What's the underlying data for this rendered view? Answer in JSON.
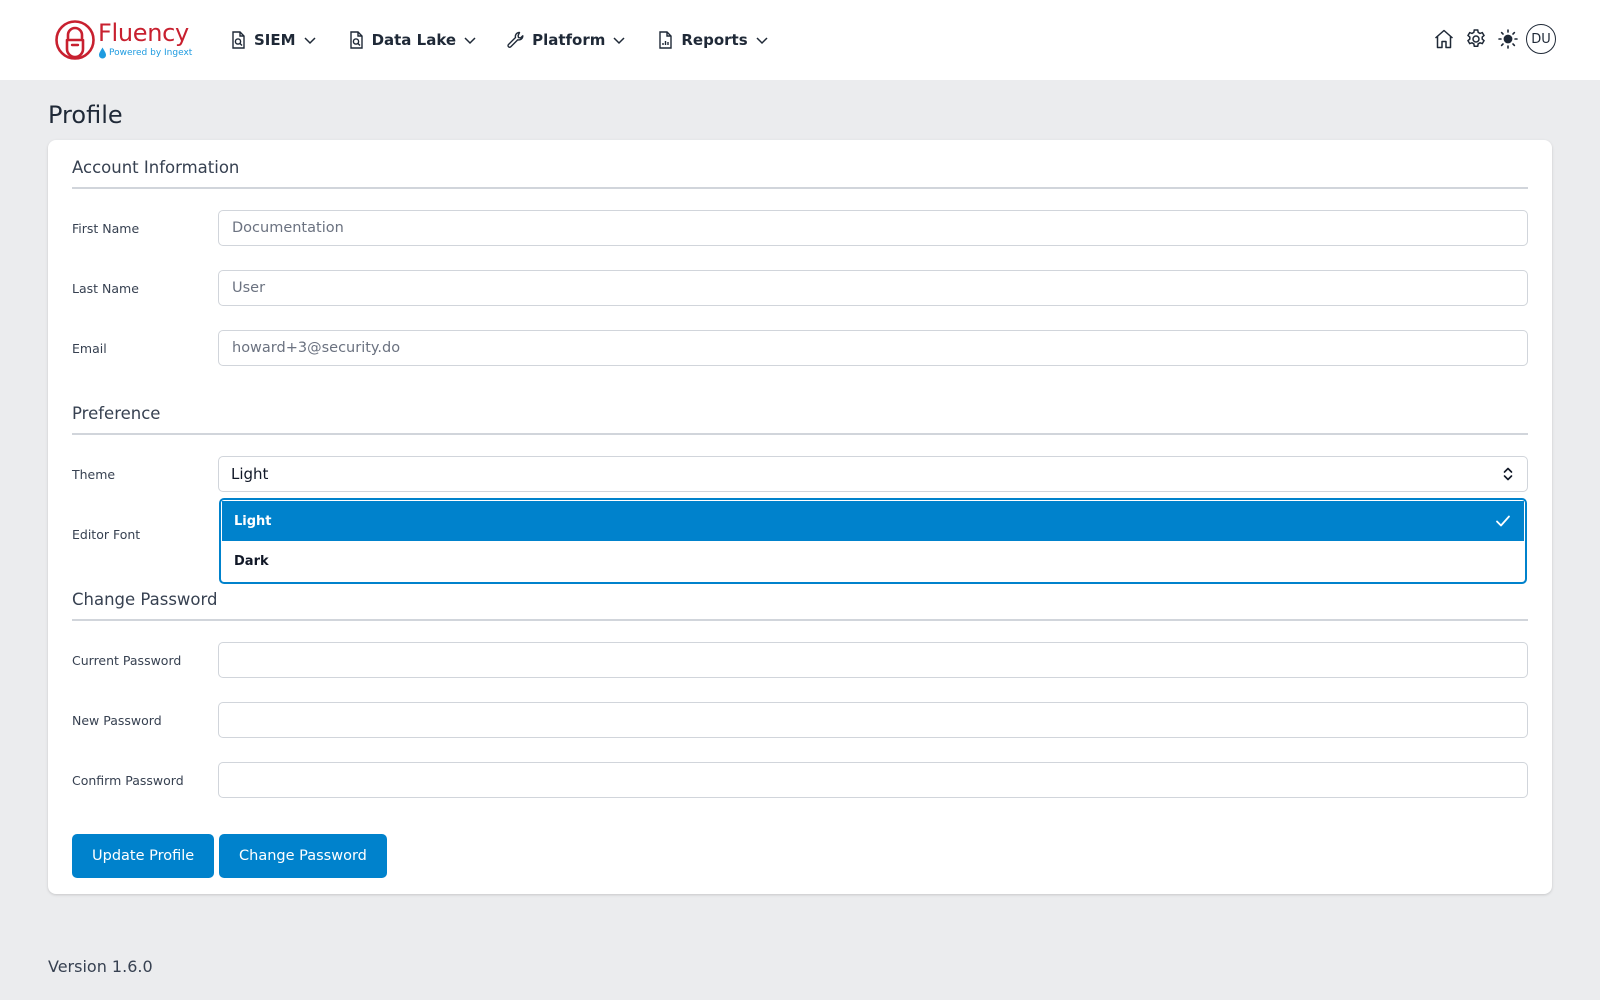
{
  "brand": {
    "name": "Fluency",
    "tagline": "Powered by Ingext",
    "primary_color": "#c8202f",
    "accent_color": "#1e9be0"
  },
  "nav": {
    "items": [
      {
        "label": "SIEM",
        "icon": "file-search-icon"
      },
      {
        "label": "Data Lake",
        "icon": "file-search-icon"
      },
      {
        "label": "Platform",
        "icon": "wrench-icon"
      },
      {
        "label": "Reports",
        "icon": "file-chart-icon"
      }
    ],
    "right_icons": [
      "home-icon",
      "gear-icon",
      "sun-icon"
    ],
    "avatar_initials": "DU"
  },
  "page": {
    "title": "Profile"
  },
  "account": {
    "section_title": "Account Information",
    "first_name_label": "First Name",
    "first_name_value": "Documentation",
    "last_name_label": "Last Name",
    "last_name_value": "User",
    "email_label": "Email",
    "email_value": "howard+3@security.do"
  },
  "preference": {
    "section_title": "Preference",
    "theme_label": "Theme",
    "theme_value": "Light",
    "editor_font_label": "Editor Font",
    "theme_options": [
      {
        "label": "Light",
        "selected": true
      },
      {
        "label": "Dark",
        "selected": false
      }
    ]
  },
  "password": {
    "section_title": "Change Password",
    "current_label": "Current Password",
    "new_label": "New Password",
    "confirm_label": "Confirm Password"
  },
  "buttons": {
    "update_profile": "Update Profile",
    "change_password": "Change Password",
    "color": "#0082cc"
  },
  "footer": {
    "version": "Version 1.6.0"
  }
}
